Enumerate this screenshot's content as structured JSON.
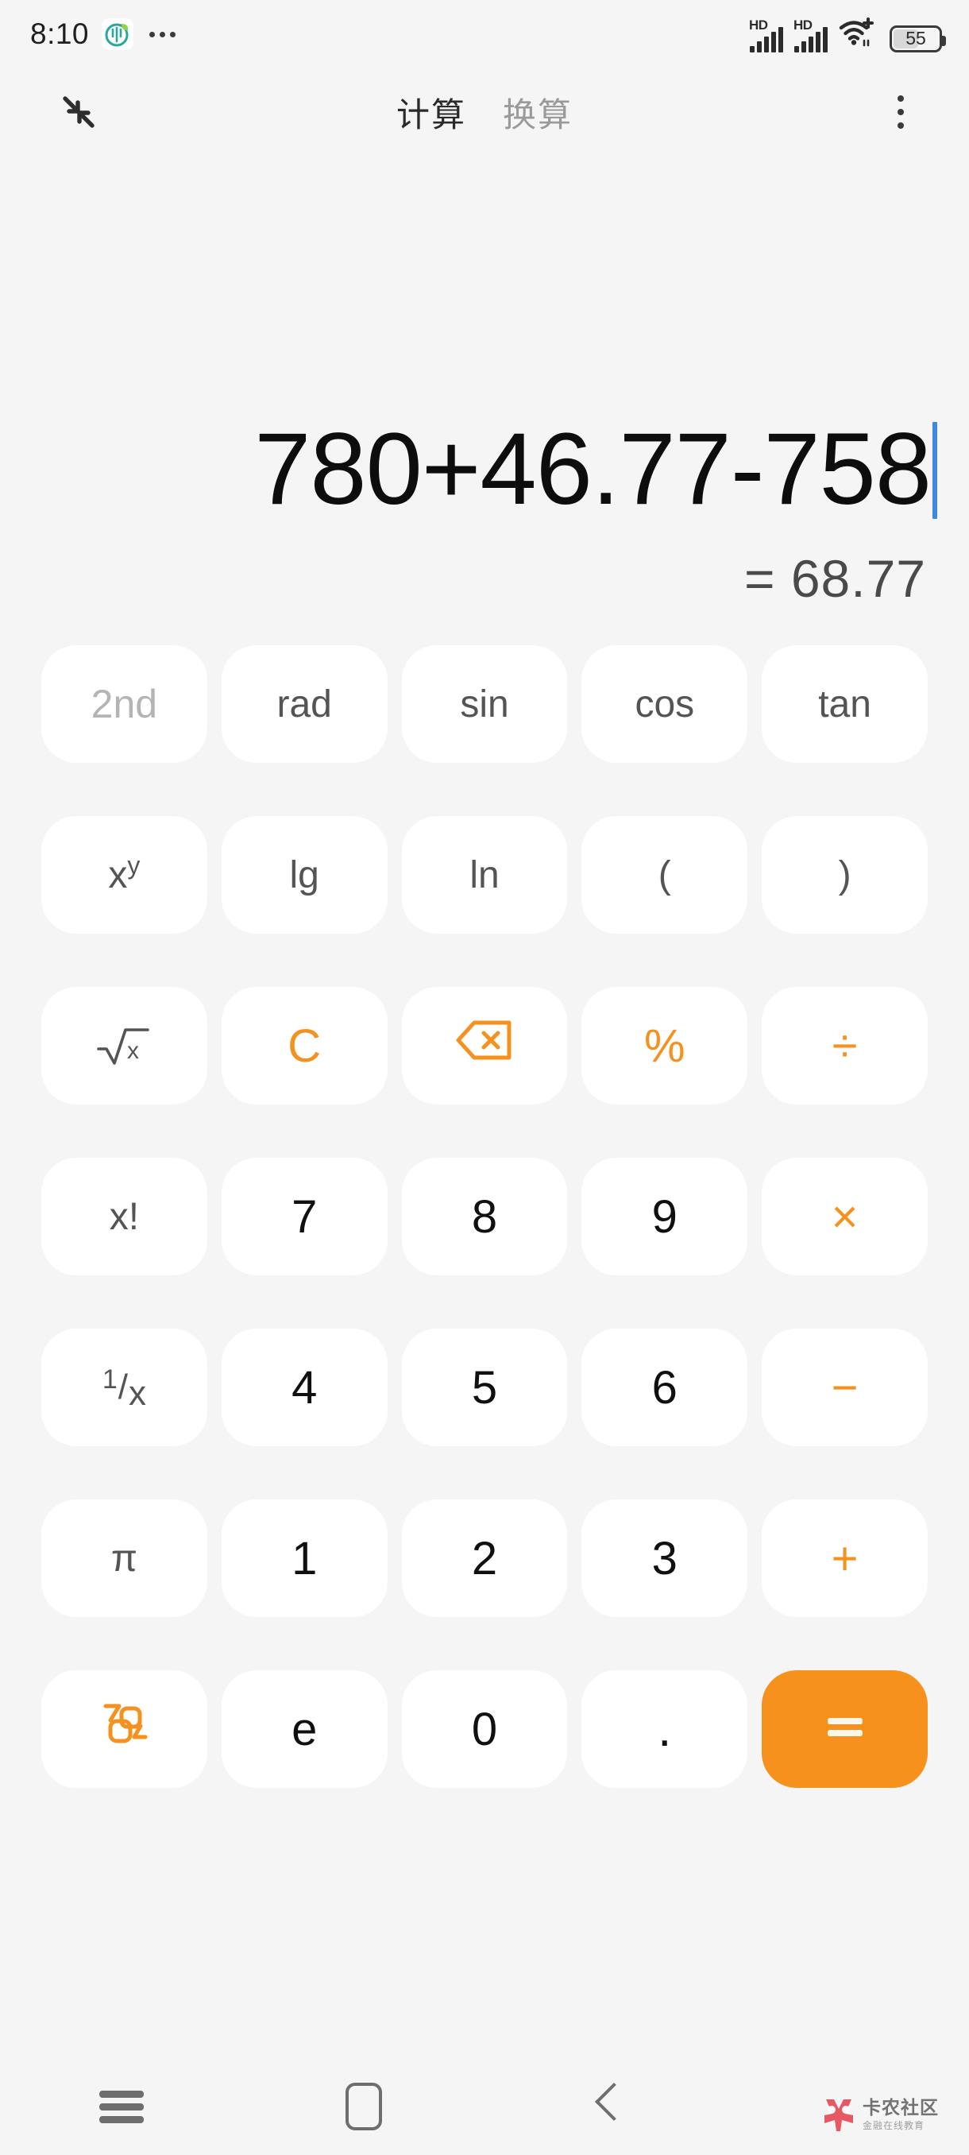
{
  "status_bar": {
    "time": "8:10",
    "app_icon": "plant-leaf-icon",
    "overflow": "•••",
    "signal_1_label": "HD",
    "signal_2_label": "HD",
    "wifi": "wifi-plus-icon",
    "battery_level": "55"
  },
  "header": {
    "collapse_icon": "collapse-arrows-icon",
    "tabs": [
      {
        "label": "计算",
        "active": true
      },
      {
        "label": "换算",
        "active": false
      }
    ],
    "menu_icon": "overflow-menu-icon"
  },
  "display": {
    "expression": "780+46.77-758",
    "result": "= 68.77",
    "caret_color": "#3f8ae0"
  },
  "colors": {
    "accent_orange": "#f7911e",
    "background": "#f5f5f6",
    "key_background": "#ffffff",
    "number_text": "#101010",
    "function_text": "#545454",
    "disabled_text": "#b4b4b4"
  },
  "keypad": {
    "rows": [
      [
        {
          "label": "2nd",
          "name": "key-2nd",
          "style": "dim"
        },
        {
          "label": "rad",
          "name": "key-rad",
          "style": "sci"
        },
        {
          "label": "sin",
          "name": "key-sin",
          "style": "sci"
        },
        {
          "label": "cos",
          "name": "key-cos",
          "style": "sci"
        },
        {
          "label": "tan",
          "name": "key-tan",
          "style": "sci"
        }
      ],
      [
        {
          "label": "x^y",
          "name": "key-power",
          "style": "sci"
        },
        {
          "label": "lg",
          "name": "key-lg",
          "style": "sci"
        },
        {
          "label": "ln",
          "name": "key-ln",
          "style": "sci"
        },
        {
          "label": "(",
          "name": "key-paren-open",
          "style": "sci"
        },
        {
          "label": ")",
          "name": "key-paren-close",
          "style": "sci"
        }
      ],
      [
        {
          "label": "√x",
          "name": "key-sqrt",
          "style": "sci"
        },
        {
          "label": "C",
          "name": "key-clear",
          "style": "op"
        },
        {
          "label": "",
          "name": "key-backspace",
          "style": "op"
        },
        {
          "label": "%",
          "name": "key-percent",
          "style": "op"
        },
        {
          "label": "÷",
          "name": "key-divide",
          "style": "op"
        }
      ],
      [
        {
          "label": "x!",
          "name": "key-factorial",
          "style": "sci"
        },
        {
          "label": "7",
          "name": "key-7",
          "style": "num"
        },
        {
          "label": "8",
          "name": "key-8",
          "style": "num"
        },
        {
          "label": "9",
          "name": "key-9",
          "style": "num"
        },
        {
          "label": "×",
          "name": "key-multiply",
          "style": "op"
        }
      ],
      [
        {
          "label": "1/x",
          "name": "key-reciprocal",
          "style": "sci"
        },
        {
          "label": "4",
          "name": "key-4",
          "style": "num"
        },
        {
          "label": "5",
          "name": "key-5",
          "style": "num"
        },
        {
          "label": "6",
          "name": "key-6",
          "style": "num"
        },
        {
          "label": "−",
          "name": "key-minus",
          "style": "op"
        }
      ],
      [
        {
          "label": "π",
          "name": "key-pi",
          "style": "sci"
        },
        {
          "label": "1",
          "name": "key-1",
          "style": "num"
        },
        {
          "label": "2",
          "name": "key-2",
          "style": "num"
        },
        {
          "label": "3",
          "name": "key-3",
          "style": "num"
        },
        {
          "label": "+",
          "name": "key-plus",
          "style": "op"
        }
      ],
      [
        {
          "label": "",
          "name": "key-number-format",
          "style": "op"
        },
        {
          "label": "e",
          "name": "key-e",
          "style": "num"
        },
        {
          "label": "0",
          "name": "key-0",
          "style": "num"
        },
        {
          "label": ".",
          "name": "key-decimal",
          "style": "dot"
        },
        {
          "label": "=",
          "name": "key-equals",
          "style": "equals"
        }
      ]
    ]
  },
  "navbar": {
    "recents_icon": "recents-icon",
    "home_icon": "home-icon",
    "back_icon": "back-icon",
    "watermark_title": "卡农社区",
    "watermark_subtitle": "金融在线教育"
  }
}
